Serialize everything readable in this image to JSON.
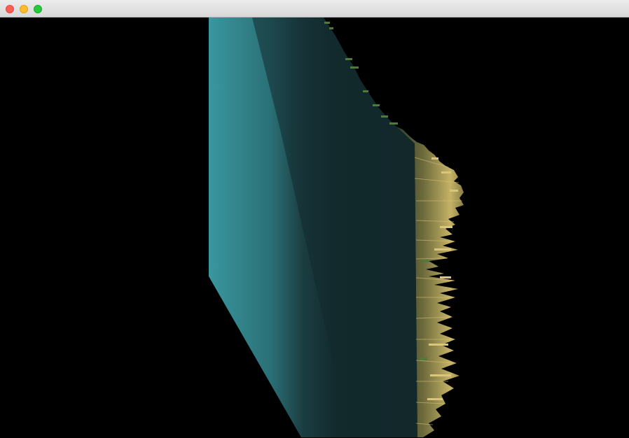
{
  "window": {
    "title": "",
    "controls": {
      "close": "close-icon",
      "minimize": "minimize-icon",
      "zoom": "zoom-icon"
    }
  },
  "scene": {
    "background": "#000000",
    "surface_colors": {
      "lit_face": "#3a979f",
      "shadow_face": "#132a2d",
      "ridge_highlight": "#c9b86a",
      "ridge_mid": "#7a7343",
      "ridge_green": "#4f7a3a"
    }
  }
}
